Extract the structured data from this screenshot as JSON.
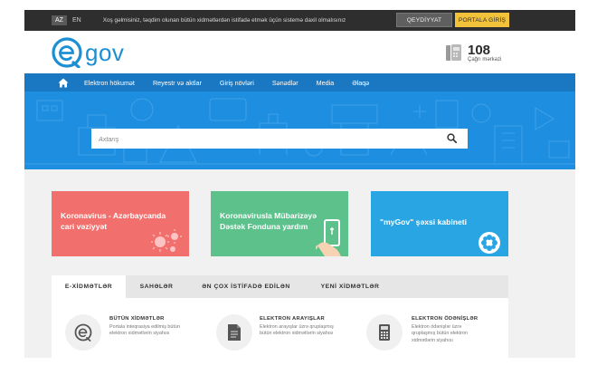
{
  "topbar": {
    "languages": [
      {
        "code": "AZ",
        "active": true
      },
      {
        "code": "EN",
        "active": false
      }
    ],
    "welcome": "Xoş gəlmisiniz, təqdim olunan bütün xidmətlərdən istifadə etmək üçün sistemə daxil olmalısınız",
    "register_label": "QEYDİYYAT",
    "login_label": "PORTALA GİRİŞ"
  },
  "header": {
    "logo_text": "gov",
    "call_number": "108",
    "call_label": "Çağrı mərkəzi"
  },
  "nav": {
    "items": [
      "Elektron hökumət",
      "Reyestr və aktlar",
      "Giriş növləri",
      "Sənədlər",
      "Media",
      "Əlaqə"
    ]
  },
  "hero": {
    "search_placeholder": "Axtarış"
  },
  "cards": [
    {
      "line1": "Koronavirus - Azərbaycanda",
      "line2": "cari vəziyyət"
    },
    {
      "line1": "Koronavirusla Mübarizəyə",
      "line2": "Dəstək Fonduna yardım"
    },
    {
      "line1": "\"myGov\" şəxsi kabineti",
      "line2": ""
    }
  ],
  "tabs": [
    {
      "label": "E-XİDMƏTLƏR",
      "active": true
    },
    {
      "label": "SAHƏLƏR",
      "active": false
    },
    {
      "label": "ƏN ÇOX İSTİFADƏ EDİLƏN",
      "active": false
    },
    {
      "label": "YENİ XİDMƏTLƏR",
      "active": false
    }
  ],
  "services": [
    {
      "title": "BÜTÜN XİDMƏTLƏR",
      "desc": "Portala inteqrasiya edilmiş bütün elektron xidmətlərin siyahısı",
      "icon": "e-logo-icon"
    },
    {
      "title": "ELEKTRON ARAYIŞLAR",
      "desc": "Elektron arayışlar üzrə qruplaşmış bütün elektron xidmətlərin siyahısı",
      "icon": "document-icon"
    },
    {
      "title": "ELEKTRON ÖDƏNİŞLƏR",
      "desc": "Elektron ödənişlər üzrə qruplaşmış bütün elektron xidmətlərin siyahısı",
      "icon": "calculator-icon"
    }
  ],
  "colors": {
    "brand_blue": "#1a78c2",
    "hero_blue": "#1e8fe0",
    "login_yellow": "#f2c23a",
    "card_red": "#f1706d",
    "card_green": "#5dc18b",
    "card_blue": "#2aa5e4"
  }
}
